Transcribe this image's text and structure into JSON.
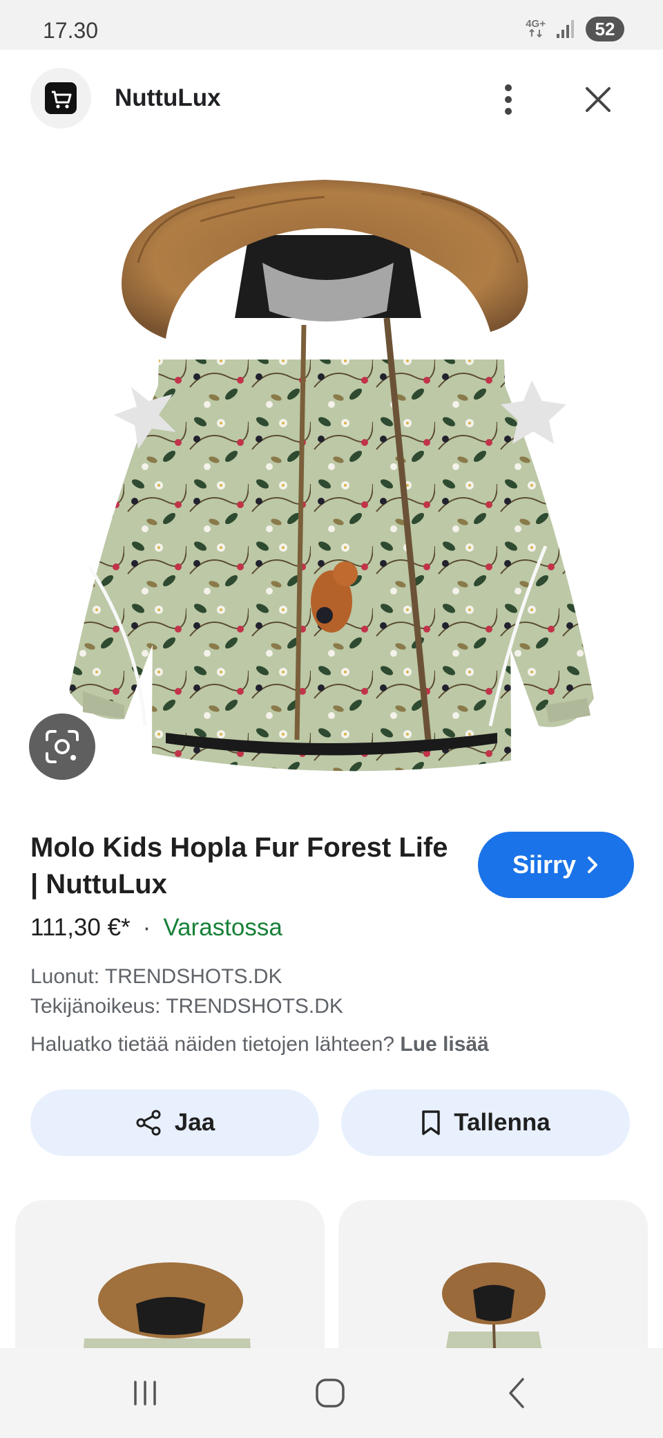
{
  "status_bar": {
    "time": "17.30",
    "network": "4G+",
    "battery": "52"
  },
  "header": {
    "site_name": "NuttuLux",
    "logo_icon": "shopping-cart-icon",
    "more_icon": "more-vert-icon",
    "close_icon": "close-icon"
  },
  "image": {
    "lens_icon": "google-lens-icon"
  },
  "product": {
    "title": "Molo Kids Hopla Fur Forest Life | NuttuLux",
    "go_label": "Siirry",
    "price": "111,30 €*",
    "separator": "·",
    "stock": "Varastossa",
    "created_by": "Luonut: TRENDSHOTS.DK",
    "copyright": "Tekijänoikeus: TRENDSHOTS.DK",
    "source_question": "Haluatko tietää näiden tietojen lähteen?",
    "learn_more": "Lue lisää"
  },
  "actions": {
    "share_label": "Jaa",
    "save_label": "Tallenna"
  },
  "colors": {
    "accent": "#1a73e8",
    "stock_green": "#188038",
    "action_bg": "#e8f0fe"
  }
}
